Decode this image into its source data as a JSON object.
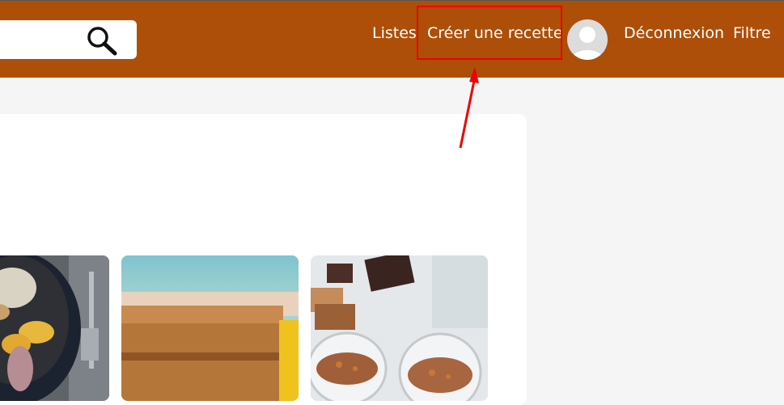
{
  "header": {
    "background": "#ad4f08",
    "nav": {
      "lists": "Listes",
      "create_recipe": "Créer une recette",
      "logout": "Déconnexion",
      "filter": "Filtre"
    }
  },
  "search": {
    "icon": "search-icon",
    "placeholder": ""
  },
  "recipes": [
    {
      "image": "stew-pot-photo"
    },
    {
      "image": "cake-slice-photo"
    },
    {
      "image": "chocolate-mousse-photo"
    }
  ],
  "annotation": {
    "color": "#ee0000"
  }
}
